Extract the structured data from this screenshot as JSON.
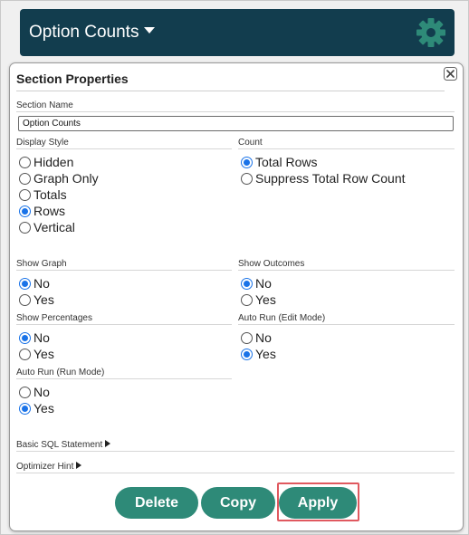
{
  "header": {
    "title": "Option Counts",
    "accent_color": "#123d4e",
    "gear_color": "#2e8a78"
  },
  "dialog": {
    "title": "Section Properties",
    "section_name": {
      "label": "Section Name",
      "value": "Option Counts"
    },
    "display_style": {
      "label": "Display Style",
      "options": [
        {
          "label": "Hidden",
          "checked": false
        },
        {
          "label": "Graph Only",
          "checked": false
        },
        {
          "label": "Totals",
          "checked": false
        },
        {
          "label": "Rows",
          "checked": true
        },
        {
          "label": "Vertical",
          "checked": false
        }
      ]
    },
    "count": {
      "label": "Count",
      "options": [
        {
          "label": "Total Rows",
          "checked": true
        },
        {
          "label": "Suppress Total Row Count",
          "checked": false
        }
      ]
    },
    "show_graph": {
      "label": "Show Graph",
      "options": [
        {
          "label": "No",
          "checked": true
        },
        {
          "label": "Yes",
          "checked": false
        }
      ]
    },
    "show_outcomes": {
      "label": "Show Outcomes",
      "options": [
        {
          "label": "No",
          "checked": true
        },
        {
          "label": "Yes",
          "checked": false
        }
      ]
    },
    "show_percentages": {
      "label": "Show Percentages",
      "options": [
        {
          "label": "No",
          "checked": true
        },
        {
          "label": "Yes",
          "checked": false
        }
      ]
    },
    "auto_run_edit": {
      "label": "Auto Run (Edit Mode)",
      "options": [
        {
          "label": "No",
          "checked": false
        },
        {
          "label": "Yes",
          "checked": true
        }
      ]
    },
    "auto_run_run": {
      "label": "Auto Run (Run Mode)",
      "options": [
        {
          "label": "No",
          "checked": false
        },
        {
          "label": "Yes",
          "checked": true
        }
      ]
    },
    "basic_sql": {
      "label": "Basic SQL Statement"
    },
    "optimizer_hint": {
      "label": "Optimizer Hint"
    },
    "buttons": {
      "delete": "Delete",
      "copy": "Copy",
      "apply": "Apply"
    },
    "button_color": "#2e8a78",
    "highlight_color": "#e0595f",
    "radio_checked_color": "#1a73e8"
  }
}
